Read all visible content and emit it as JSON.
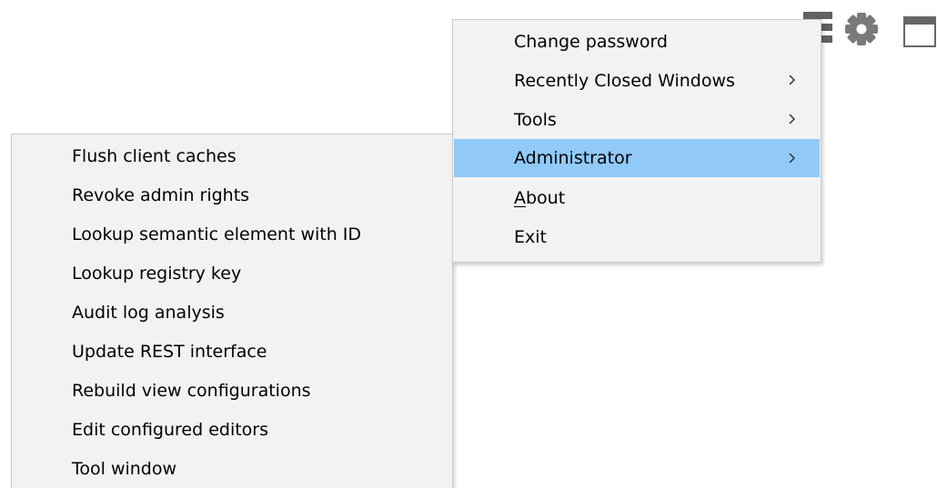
{
  "main_menu": {
    "items": [
      {
        "label": "Change password",
        "has_submenu": false,
        "highlighted": false
      },
      {
        "label": "Recently Closed Windows",
        "has_submenu": true,
        "highlighted": false
      },
      {
        "label": "Tools",
        "has_submenu": true,
        "highlighted": false
      },
      {
        "label": "Administrator",
        "has_submenu": true,
        "highlighted": true
      },
      {
        "label_accel": "A",
        "label_rest": "bout",
        "has_submenu": false,
        "highlighted": false
      },
      {
        "label": "Exit",
        "has_submenu": false,
        "highlighted": false
      }
    ]
  },
  "admin_submenu": {
    "items": [
      {
        "label": "Flush client caches"
      },
      {
        "label": "Revoke admin rights"
      },
      {
        "label": "Lookup semantic element with ID"
      },
      {
        "label": "Lookup registry key"
      },
      {
        "label": "Audit log analysis"
      },
      {
        "label": "Update REST interface"
      },
      {
        "label": "Rebuild view configurations"
      },
      {
        "label": "Edit configured editors"
      },
      {
        "label": "Tool window"
      }
    ]
  },
  "toolbar": {
    "icons": [
      "hamburger-menu-icon",
      "gear-icon",
      "window-icon"
    ]
  },
  "colors": {
    "menu_background": "#f2f2f2",
    "menu_border": "#cccccc",
    "highlight": "#91c9f7",
    "icon_gray": "#616161"
  }
}
